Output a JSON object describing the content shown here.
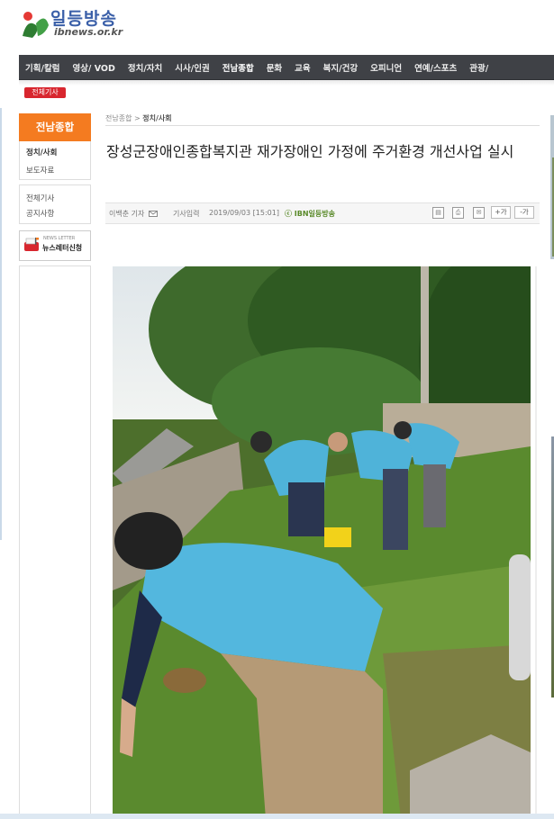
{
  "site": {
    "logo_text": "일등방송",
    "logo_sub": "ibnews.or.kr"
  },
  "nav": {
    "items": [
      "기획/칼럼",
      "영상/ VOD",
      "정치/자치",
      "시사/인권",
      "전남종합",
      "문화",
      "교육",
      "복지/건강",
      "오피니언",
      "연예/스포츠",
      "관광/"
    ],
    "active_index": 4,
    "all_articles": "전체기사"
  },
  "sidebar": {
    "header": "전남종합",
    "items": [
      "정치/사회",
      "보도자료"
    ],
    "links": [
      "전체기사",
      "공지사항"
    ],
    "banner_small": "NEWS LETTER",
    "banner_label": "뉴스레터신청"
  },
  "article": {
    "breadcrumb_parent": "전남종합",
    "breadcrumb_sep": ">",
    "breadcrumb_current": "정치/사회",
    "title": "장성군장애인종합복지관 재가장애인 가정에 주거환경 개선사업 실시",
    "reporter": "이백춘 기자",
    "date_label": "기사입력",
    "date": "2019/09/03 [15:01]",
    "source": "ⓒ IBN일등방송",
    "font_plus": "+가",
    "font_minus": "-가"
  },
  "colors": {
    "nav_bg": "#3f4146",
    "accent_orange": "#f47b20",
    "accent_red": "#d8262e",
    "logo_blue": "#3a5fa8"
  }
}
